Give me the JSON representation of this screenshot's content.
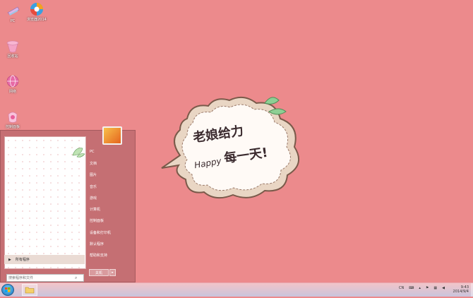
{
  "desktop": {
    "icons": [
      {
        "label": "PC",
        "icon": "computer-icon"
      },
      {
        "label": "浏览器2014",
        "icon": "browser-icon"
      },
      {
        "label": "回收站",
        "icon": "recycle-bin-icon"
      },
      {
        "label": "网络",
        "icon": "network-icon"
      },
      {
        "label": "控制面板",
        "icon": "control-panel-icon"
      }
    ],
    "wallpaper": {
      "line1": "老娘给力",
      "line2": "每一天!",
      "happy": "Happy"
    }
  },
  "start_menu": {
    "all_programs": "所有程序",
    "search_placeholder": "搜索程序和文件",
    "right_items": [
      {
        "label": "PC"
      },
      {
        "label": "文档"
      },
      {
        "label": "图片"
      },
      {
        "label": "音乐"
      },
      {
        "label": "游戏"
      },
      {
        "label": "计算机"
      },
      {
        "label": "控制面板"
      },
      {
        "label": "设备和打印机"
      },
      {
        "label": "默认程序"
      },
      {
        "label": "帮助和支持"
      }
    ],
    "shutdown_label": "关机"
  },
  "taskbar": {
    "tray_lang": "CN",
    "clock_time": "9:43",
    "clock_date": "2014/9/4"
  },
  "colors": {
    "desktop_bg": "#ec8a8c",
    "start_menu_bg": "#c56f73"
  }
}
